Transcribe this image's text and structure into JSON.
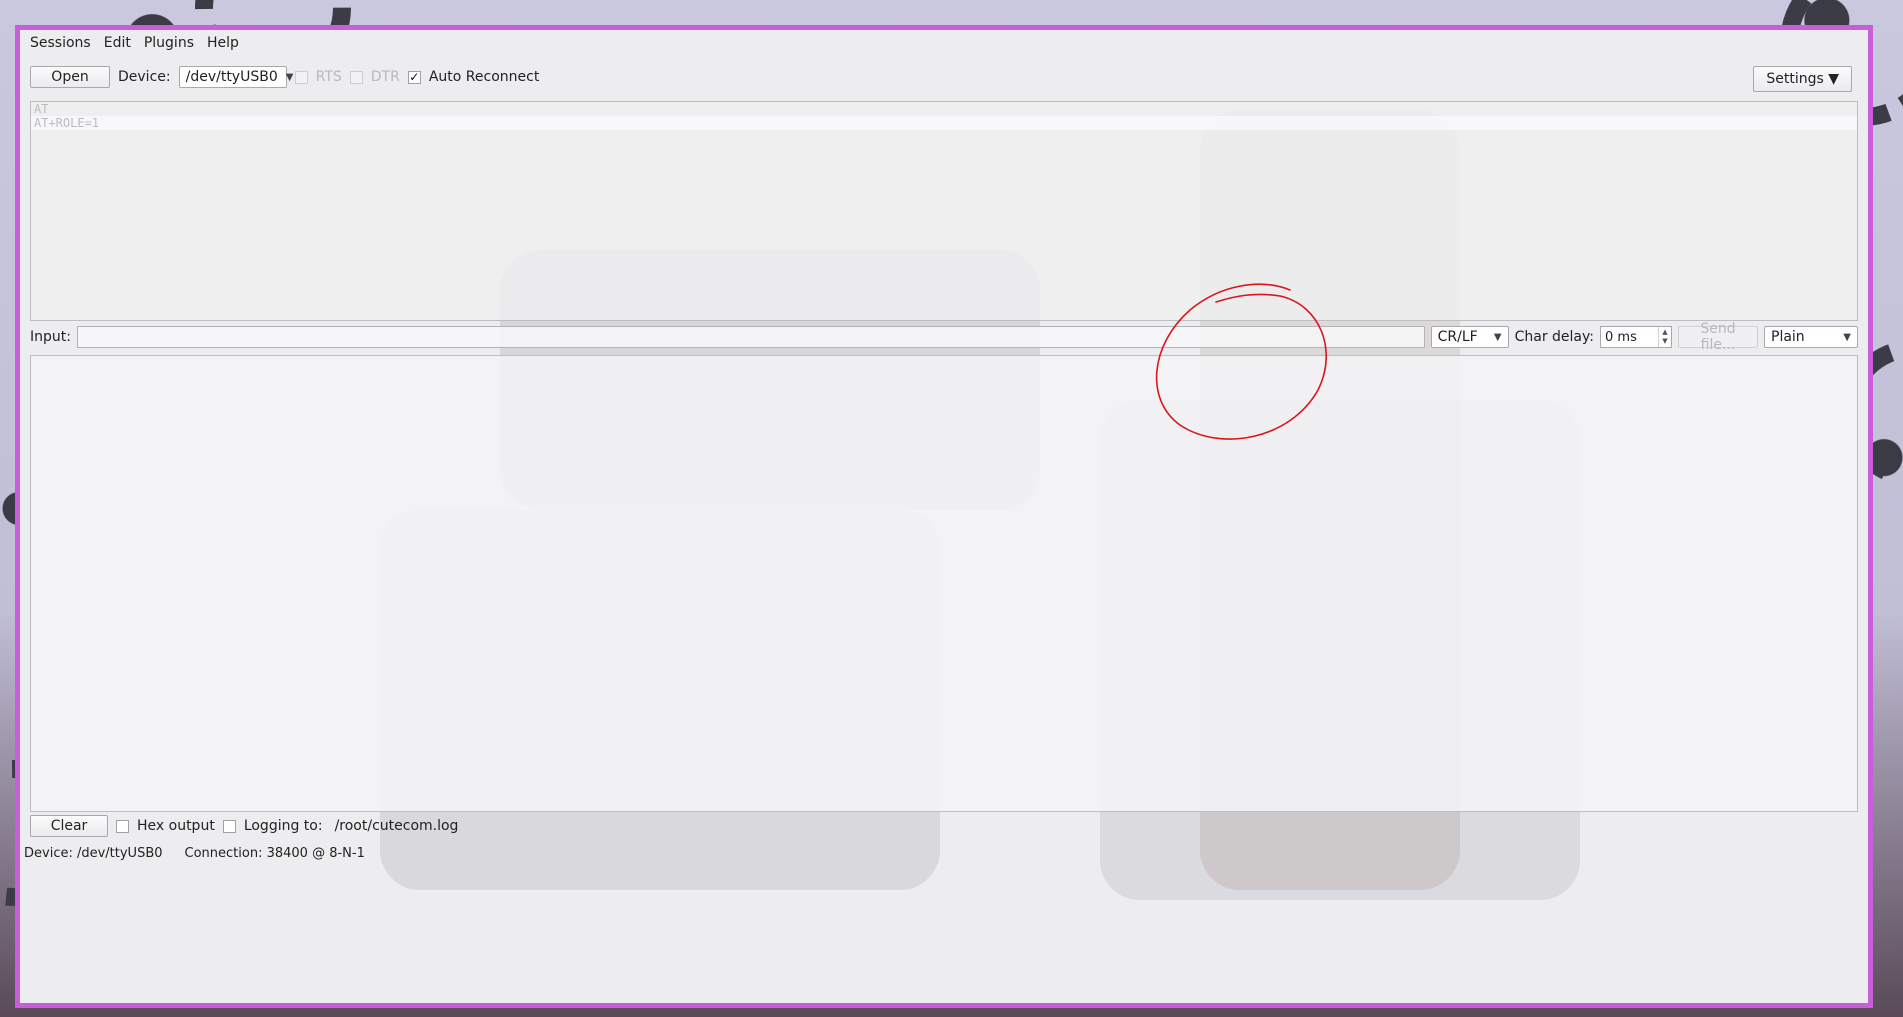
{
  "menu": {
    "sessions": "Sessions",
    "edit": "Edit",
    "plugins": "Plugins",
    "help": "Help"
  },
  "toolbar": {
    "open_label": "Open",
    "device_label": "Device:",
    "device_value": "/dev/ttyUSB0",
    "rts_label": "RTS",
    "dtr_label": "DTR",
    "auto_reconnect_label": "Auto Reconnect",
    "auto_reconnect_checked": "✓",
    "settings_label": "Settings ▼"
  },
  "sent_history": [
    "AT",
    "AT+ROLE=1"
  ],
  "input_row": {
    "input_label": "Input:",
    "line_ending": "CR/LF",
    "char_delay_label": "Char delay:",
    "char_delay_value": "0 ms",
    "send_file_label": "Send file...",
    "format_value": "Plain"
  },
  "bottom": {
    "clear_label": "Clear",
    "hex_output_label": "Hex output",
    "logging_label": "Logging to:",
    "log_path": "/root/cutecom.log"
  },
  "status": {
    "device": "Device:  /dev/ttyUSB0",
    "connection": "Connection:  38400 @ 8-N-1"
  },
  "colors": {
    "window_border": "#c65fd8",
    "annotation": "#d9161b"
  }
}
